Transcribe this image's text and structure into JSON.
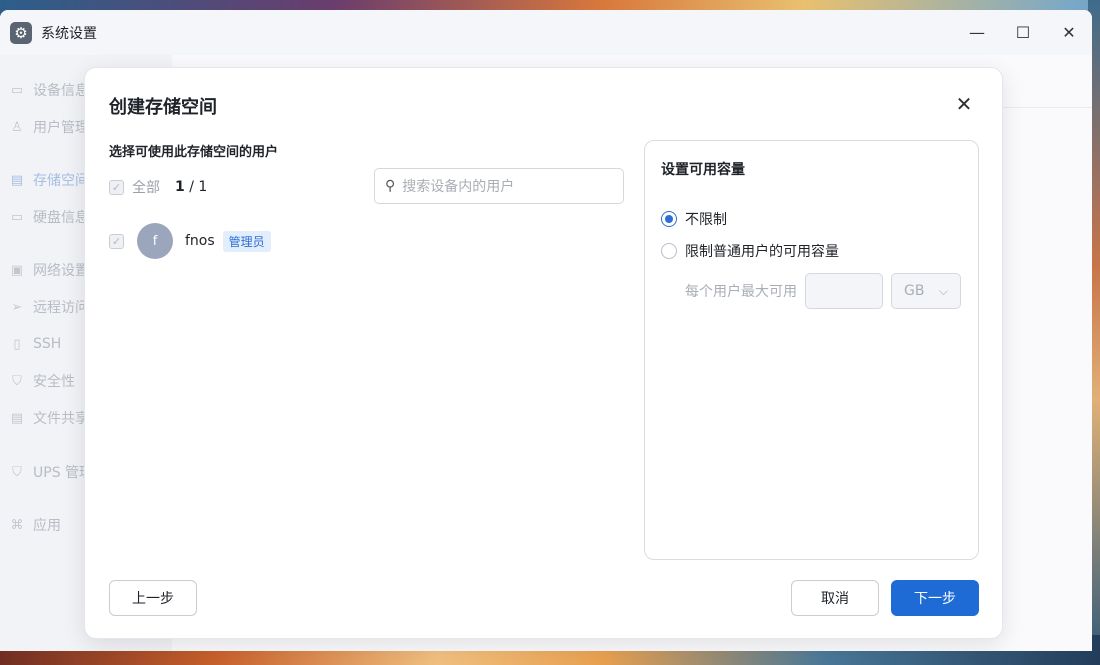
{
  "window": {
    "title": "系统设置",
    "controls": {
      "minimize": "—",
      "maximize": "☐",
      "close": "✕"
    }
  },
  "sidebar": {
    "items": [
      {
        "label": "设备信息",
        "icon": "device-icon",
        "active": false
      },
      {
        "label": "用户管理",
        "icon": "user-icon",
        "active": false
      },
      {
        "label": "存储空间",
        "icon": "storage-icon",
        "active": true
      },
      {
        "label": "硬盘信息",
        "icon": "disk-icon",
        "active": false
      },
      {
        "label": "网络设置",
        "icon": "network-icon",
        "active": false
      },
      {
        "label": "远程访问",
        "icon": "send-icon",
        "active": false
      },
      {
        "label": "SSH",
        "icon": "terminal-icon",
        "active": false
      },
      {
        "label": "安全性",
        "icon": "shield-icon",
        "active": false
      },
      {
        "label": "文件共享",
        "icon": "file-icon",
        "active": false
      },
      {
        "label": "UPS 管理",
        "icon": "ups-icon",
        "active": false
      },
      {
        "label": "应用",
        "icon": "apps-icon",
        "active": false
      }
    ]
  },
  "dialog": {
    "title": "创建存储空间",
    "close_glyph": "✕",
    "users_section_label": "选择可使用此存储空间的用户",
    "select_all_label": "全部",
    "selected_count": "1",
    "total_count": "/ 1",
    "search": {
      "placeholder": "搜索设备内的用户"
    },
    "users": [
      {
        "avatar_letter": "f",
        "name": "fnos",
        "role_badge": "管理员",
        "checked": true
      }
    ],
    "quota_panel": {
      "title": "设置可用容量",
      "option_unlimited": "不限制",
      "option_limit": "限制普通用户的可用容量",
      "selected_option": "unlimited",
      "max_label": "每个用户最大可用",
      "max_value": "",
      "unit": "GB"
    },
    "buttons": {
      "prev": "上一步",
      "cancel": "取消",
      "next": "下一步"
    }
  },
  "colors": {
    "accent": "#1f6bd6",
    "badge_bg": "#e3eefc",
    "sidebar_active": "#7fa3d6"
  }
}
